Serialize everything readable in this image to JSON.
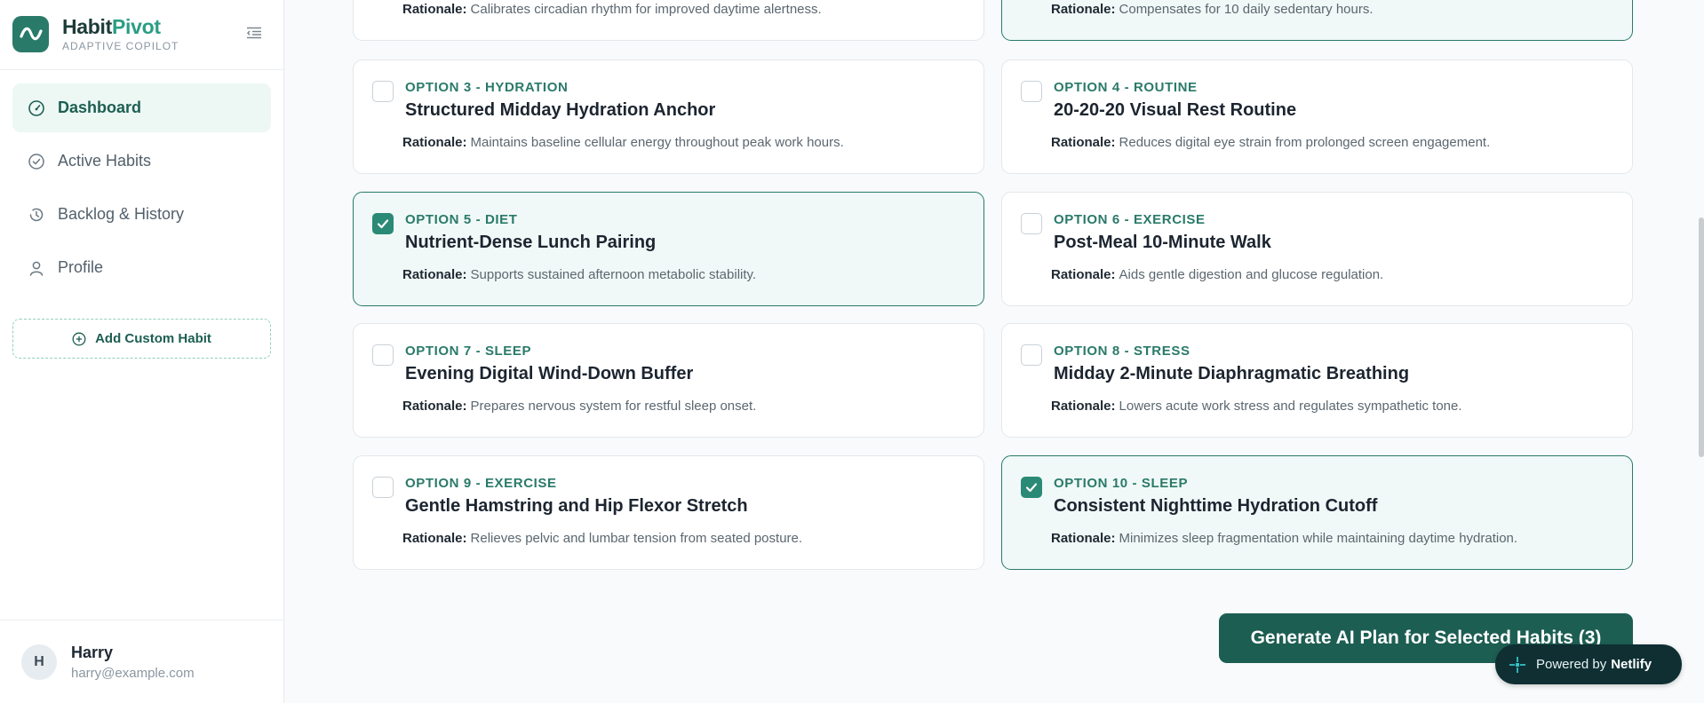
{
  "brand": {
    "name_part1": "Habit",
    "name_part2": "Pivot",
    "subtitle": "ADAPTIVE COPILOT",
    "logo_icon": "wave-icon",
    "accent_color": "#2a7a6a"
  },
  "sidebar": {
    "collapse_icon": "menu-collapse-icon",
    "nav": [
      {
        "label": "Dashboard",
        "icon": "gauge-icon",
        "active": true
      },
      {
        "label": "Active Habits",
        "icon": "check-circle-icon",
        "active": false
      },
      {
        "label": "Backlog & History",
        "icon": "history-icon",
        "active": false
      },
      {
        "label": "Profile",
        "icon": "user-icon",
        "active": false
      }
    ],
    "add_custom_label": "Add Custom Habit"
  },
  "user": {
    "initial": "H",
    "name": "Harry",
    "email": "harry@example.com"
  },
  "rationale_label": "Rationale:",
  "partial_cards": [
    {
      "rationale": "Calibrates circadian rhythm for improved daytime alertness.",
      "selected": false
    },
    {
      "rationale": "Compensates for 10 daily sedentary hours.",
      "selected": true
    }
  ],
  "options": [
    {
      "label": "OPTION 3 - HYDRATION",
      "title": "Structured Midday Hydration Anchor",
      "rationale": "Maintains baseline cellular energy throughout peak work hours.",
      "selected": false
    },
    {
      "label": "OPTION 4 - ROUTINE",
      "title": "20-20-20 Visual Rest Routine",
      "rationale": "Reduces digital eye strain from prolonged screen engagement.",
      "selected": false
    },
    {
      "label": "OPTION 5 - DIET",
      "title": "Nutrient-Dense Lunch Pairing",
      "rationale": "Supports sustained afternoon metabolic stability.",
      "selected": true
    },
    {
      "label": "OPTION 6 - EXERCISE",
      "title": "Post-Meal 10-Minute Walk",
      "rationale": "Aids gentle digestion and glucose regulation.",
      "selected": false
    },
    {
      "label": "OPTION 7 - SLEEP",
      "title": "Evening Digital Wind-Down Buffer",
      "rationale": "Prepares nervous system for restful sleep onset.",
      "selected": false
    },
    {
      "label": "OPTION 8 - STRESS",
      "title": "Midday 2-Minute Diaphragmatic Breathing",
      "rationale": "Lowers acute work stress and regulates sympathetic tone.",
      "selected": false
    },
    {
      "label": "OPTION 9 - EXERCISE",
      "title": "Gentle Hamstring and Hip Flexor Stretch",
      "rationale": "Relieves pelvic and lumbar tension from seated posture.",
      "selected": false
    },
    {
      "label": "OPTION 10 - SLEEP",
      "title": "Consistent Nighttime Hydration Cutoff",
      "rationale": "Minimizes sleep fragmentation while maintaining daytime hydration.",
      "selected": true
    }
  ],
  "generate_button_label": "Generate AI Plan for Selected Habits (3)",
  "netlify_badge": {
    "prefix": "Powered by",
    "brand": "Netlify"
  }
}
